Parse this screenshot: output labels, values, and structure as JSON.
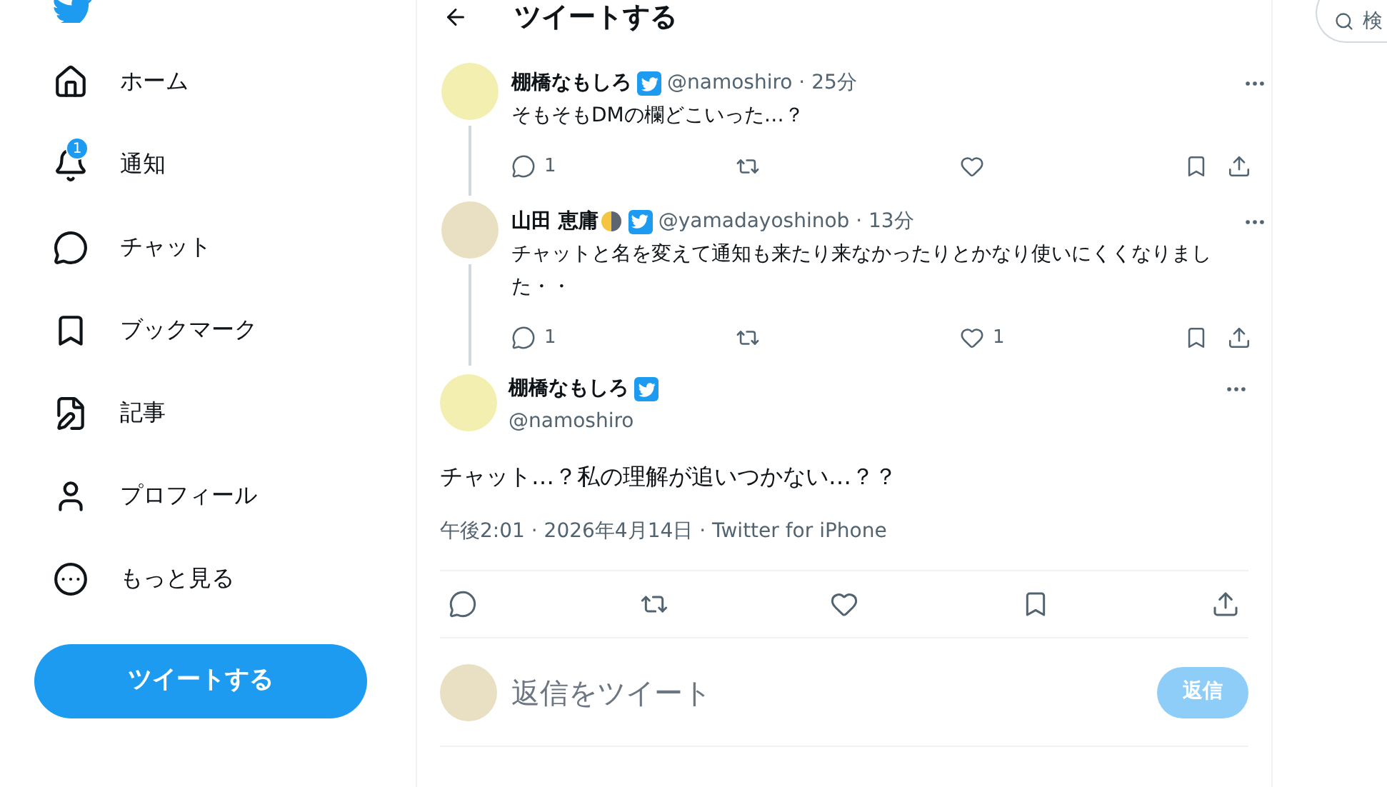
{
  "nav": [
    {
      "kind": "home",
      "label": "ホーム"
    },
    {
      "kind": "bell",
      "label": "通知",
      "badge": "1"
    },
    {
      "kind": "chat",
      "label": "チャット"
    },
    {
      "kind": "bookmark",
      "label": "ブックマーク"
    },
    {
      "kind": "article",
      "label": "記事"
    },
    {
      "kind": "profile",
      "label": "プロフィール"
    },
    {
      "kind": "more",
      "label": "もっと見る"
    }
  ],
  "tweet_button": "ツイートする",
  "header": {
    "title": "ツイートする"
  },
  "thread": [
    {
      "name": "棚橋なもしろ",
      "emoji": false,
      "verified": true,
      "handle_time": "@namoshiro · 25分",
      "text": "そもそもDMの欄どこいった…？",
      "actions": [
        {
          "kind": "reply",
          "count": "1"
        },
        {
          "kind": "retweet"
        },
        {
          "kind": "like"
        },
        {
          "kind": "bookmark"
        },
        {
          "kind": "share"
        }
      ]
    },
    {
      "name": "山田 恵庸",
      "emoji": true,
      "verified": true,
      "handle_time": "@yamadayoshinob · 13分",
      "text": "チャットと名を変えて通知も来たり来なかったりとかなり使いにくくなりました・・",
      "actions": [
        {
          "kind": "reply",
          "count": "1"
        },
        {
          "kind": "retweet"
        },
        {
          "kind": "like",
          "count": "1"
        },
        {
          "kind": "bookmark"
        },
        {
          "kind": "share"
        }
      ]
    }
  ],
  "main_tweet": {
    "name": "棚橋なもしろ",
    "verified": true,
    "handle": "@namoshiro",
    "text": "チャット…？私の理解が追いつかない…？？",
    "meta": "午後2:01 · 2026年4月14日 · Twitter for iPhone",
    "actions": [
      {
        "kind": "reply"
      },
      {
        "kind": "retweet"
      },
      {
        "kind": "like"
      },
      {
        "kind": "bookmark"
      },
      {
        "kind": "share"
      }
    ]
  },
  "reply_box": {
    "placeholder": "返信をツイート",
    "button": "返信",
    "disabled": true
  },
  "search": {
    "placeholder": "検"
  }
}
